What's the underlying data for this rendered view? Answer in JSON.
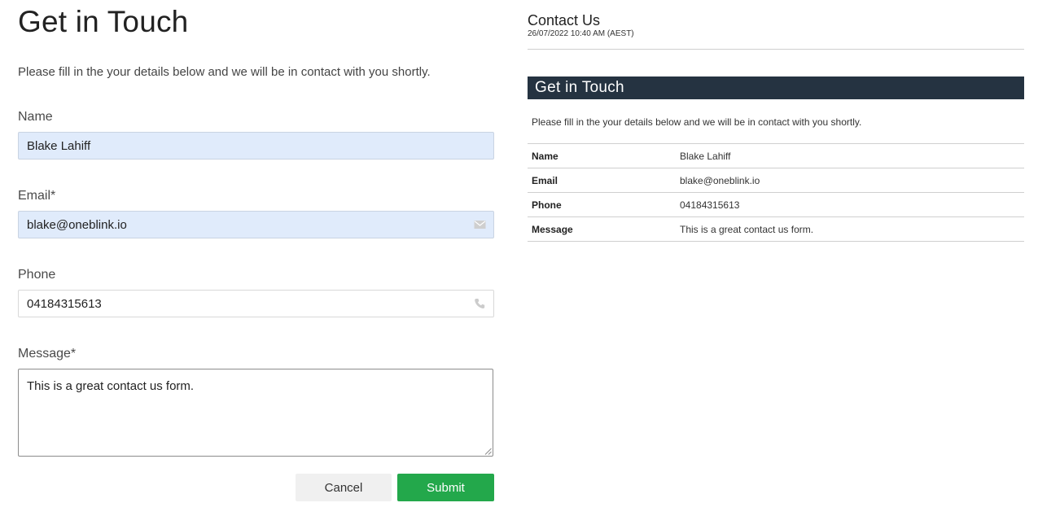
{
  "form": {
    "title": "Get in Touch",
    "description": "Please fill in the your details below and we will be in contact with you shortly.",
    "fields": {
      "name": {
        "label": "Name",
        "value": "Blake Lahiff"
      },
      "email": {
        "label": "Email*",
        "value": "blake@oneblink.io",
        "icon": "envelope-icon"
      },
      "phone": {
        "label": "Phone",
        "value": "04184315613",
        "icon": "phone-icon"
      },
      "message": {
        "label": "Message*",
        "value": "This is a great contact us form."
      }
    },
    "buttons": {
      "cancel": "Cancel",
      "submit": "Submit"
    },
    "colors": {
      "submit": "#23a84b",
      "filled_input": "#e0ebfb"
    }
  },
  "summary": {
    "title": "Contact Us",
    "timestamp": "26/07/2022 10:40 AM (AEST)",
    "banner_title": "Get in Touch",
    "banner_color": "#253341",
    "description": "Please fill in the your details below and we will be in contact with you shortly.",
    "rows": [
      {
        "key": "Name",
        "value": "Blake Lahiff"
      },
      {
        "key": "Email",
        "value": "blake@oneblink.io"
      },
      {
        "key": "Phone",
        "value": "04184315613"
      },
      {
        "key": "Message",
        "value": "This is a great contact us form."
      }
    ]
  }
}
